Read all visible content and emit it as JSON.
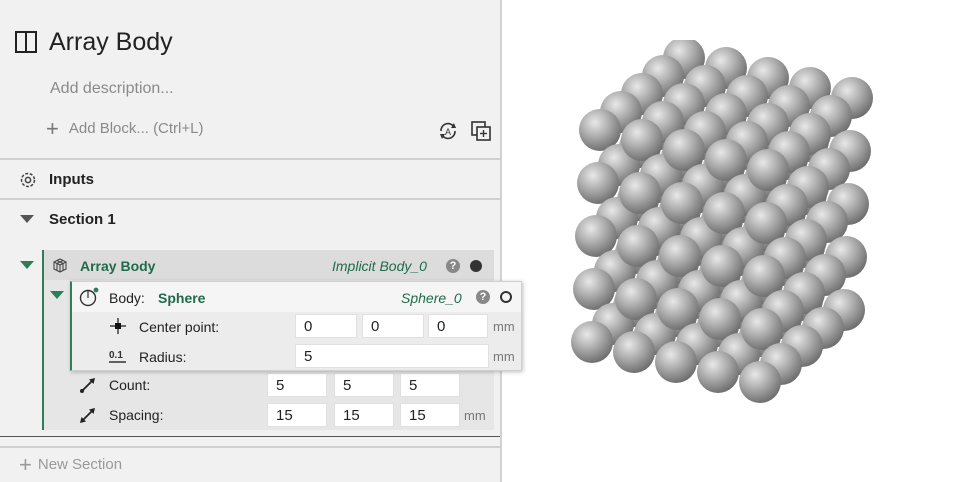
{
  "header": {
    "title": "Array Body",
    "description_placeholder": "Add description...",
    "add_block_label": "Add Block... (Ctrl+L)",
    "icons": [
      "panel-icon",
      "refresh-a-icon",
      "copy-icon"
    ]
  },
  "inputs": {
    "label": "Inputs",
    "icon": "gear-icon"
  },
  "section": {
    "label": "Section 1"
  },
  "array_block": {
    "title": "Array Body",
    "output_name": "Implicit Body_0",
    "help": "?",
    "body": {
      "label": "Body:",
      "value": "Sphere",
      "output_name": "Sphere_0",
      "help": "?",
      "center_point": {
        "label": "Center point:",
        "values": [
          "0",
          "0",
          "0"
        ],
        "unit": "mm"
      },
      "radius": {
        "label": "Radius:",
        "value": "5",
        "unit": "mm"
      }
    },
    "count": {
      "label": "Count:",
      "values": [
        "5",
        "5",
        "5"
      ]
    },
    "spacing": {
      "label": "Spacing:",
      "values": [
        "15",
        "15",
        "15"
      ],
      "unit": "mm"
    }
  },
  "footer": {
    "new_section_label": "New Section"
  },
  "colors": {
    "accent": "#2e7d5b",
    "panel_bg": "#f1f1f1",
    "sphere": "#a8a8a8"
  },
  "viewport": {
    "grid": [
      5,
      5,
      5
    ],
    "object": "sphere array"
  }
}
